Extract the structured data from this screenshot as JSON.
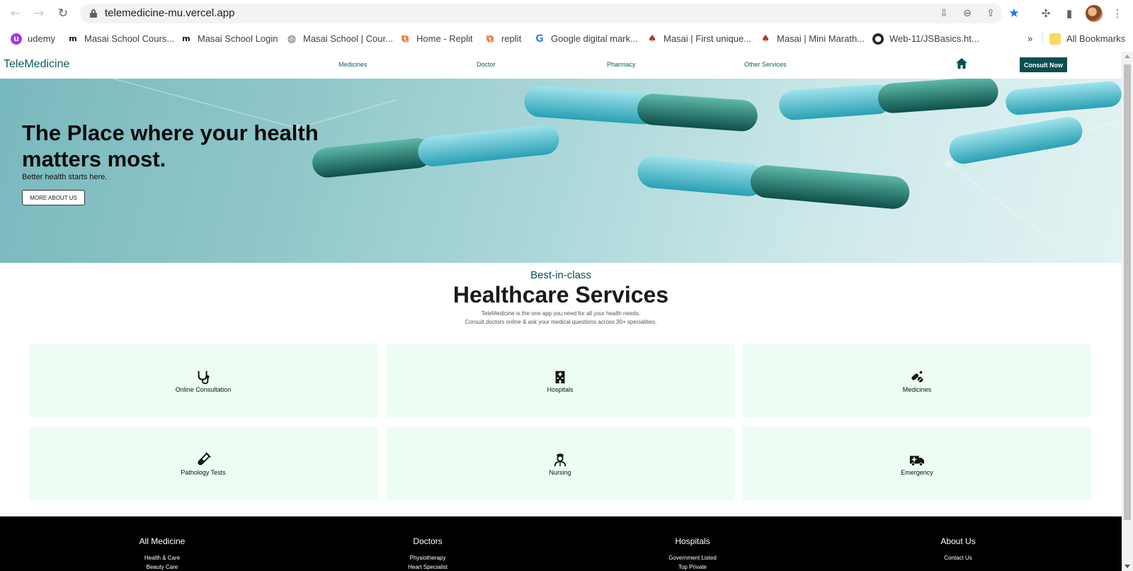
{
  "browser": {
    "url": "telemedicine-mu.vercel.app",
    "bookmarks": [
      {
        "label": "udemy",
        "color": "#a435f0"
      },
      {
        "label": "Masai School Cours...",
        "color": "#111111"
      },
      {
        "label": "Masai School Login",
        "color": "#111111"
      },
      {
        "label": "Masai School | Cour...",
        "color": "#5f6368"
      },
      {
        "label": "Home - Replit",
        "color": "#f26207"
      },
      {
        "label": "replit",
        "color": "#f26207"
      },
      {
        "label": "Google digital mark...",
        "color": "#4285f4"
      },
      {
        "label": "Masai | First unique...",
        "color": "#b03a2e"
      },
      {
        "label": "Masai | Mini Marath...",
        "color": "#b03a2e"
      },
      {
        "label": "Web-11/JSBasics.ht...",
        "color": "#24292f"
      }
    ],
    "overflow": "»",
    "all_bookmarks": "All Bookmarks"
  },
  "site": {
    "brand": "TeleMedicine",
    "nav": [
      "Medicines",
      "Doctor",
      "Pharmacy",
      "Other Services"
    ],
    "consult_label": "Consult Now",
    "accent": "#0b4f50"
  },
  "hero": {
    "title": "The Place where your health matters most.",
    "subtitle": "Better health starts here.",
    "button": "MORE ABOUT US"
  },
  "services": {
    "eyebrow": "Best-in-class",
    "title": "Healthcare Services",
    "desc_1": "TeleMedicine is the one app you need for all your health needs.",
    "desc_2": "Consult doctors online & ask your medical questions across 30+ specialities.",
    "cards": [
      {
        "label": "Online Consultation",
        "icon": "stethoscope-icon"
      },
      {
        "label": "Hospitals",
        "icon": "hospital-icon"
      },
      {
        "label": "Medicines",
        "icon": "pills-icon"
      },
      {
        "label": "Pathology Tests",
        "icon": "test-tube-icon"
      },
      {
        "label": "Nursing",
        "icon": "nurse-icon"
      },
      {
        "label": "Emergency",
        "icon": "ambulance-icon"
      }
    ],
    "card_bg": "#edfdf3"
  },
  "footer": {
    "columns": [
      {
        "heading": "All Medicine",
        "items": [
          "Health & Care",
          "Beauty Care"
        ]
      },
      {
        "heading": "Doctors",
        "items": [
          "Physiotherapy",
          "Heart Specialist"
        ]
      },
      {
        "heading": "Hospitals",
        "items": [
          "Government Listed",
          "Top Private"
        ]
      },
      {
        "heading": "About Us",
        "items": [
          "Contact Us"
        ]
      }
    ]
  }
}
